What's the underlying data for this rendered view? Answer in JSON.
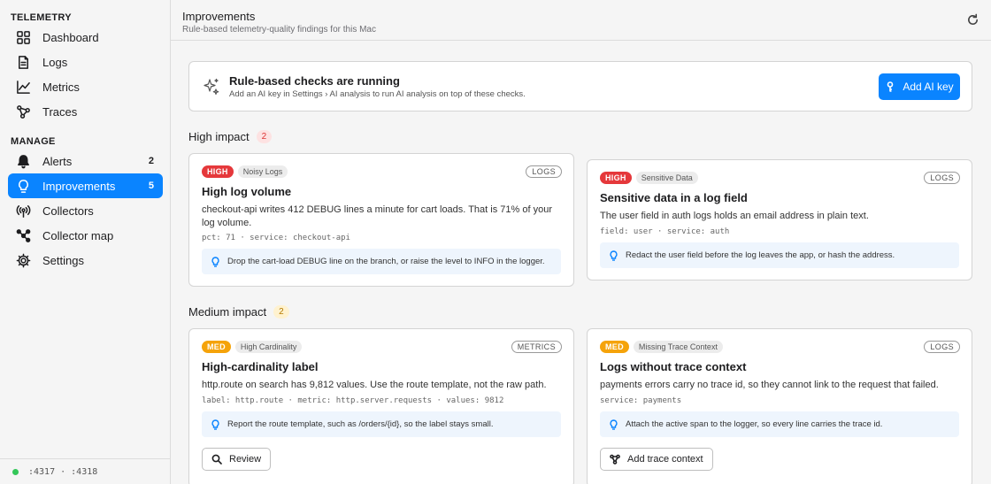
{
  "sidebar": {
    "telemetry_title": "TELEMETRY",
    "manage_title": "MANAGE",
    "items": [
      {
        "label": "Dashboard",
        "icon": "grid-icon"
      },
      {
        "label": "Logs",
        "icon": "document-icon"
      },
      {
        "label": "Metrics",
        "icon": "chart-line-icon"
      },
      {
        "label": "Traces",
        "icon": "trace-nodes-icon"
      },
      {
        "label": "Alerts",
        "icon": "bell-icon",
        "count": "2"
      },
      {
        "label": "Improvements",
        "icon": "lightbulb-icon",
        "count": "5"
      },
      {
        "label": "Collectors",
        "icon": "antenna-icon"
      },
      {
        "label": "Collector map",
        "icon": "network-icon"
      },
      {
        "label": "Settings",
        "icon": "gear-icon"
      }
    ],
    "footer": ":4317 · :4318"
  },
  "header": {
    "title": "Improvements",
    "subtitle": "Rule-based telemetry-quality findings for this Mac"
  },
  "banner": {
    "title": "Rule-based checks are running",
    "subtitle": "Add an AI key in Settings › AI analysis to run AI analysis on top of these checks.",
    "button": "Add AI key"
  },
  "groups": {
    "high": {
      "label": "High impact",
      "count": "2"
    },
    "medium": {
      "label": "Medium impact",
      "count": "2"
    }
  },
  "cards": [
    {
      "severity": "HIGH",
      "category": "Noisy Logs",
      "source": "LOGS",
      "title": "High log volume",
      "description": "checkout-api writes 412 DEBUG lines a minute for cart loads. That is 71% of your log volume.",
      "meta": "pct: 71 · service: checkout-api",
      "hint": "Drop the cart-load DEBUG line on the branch, or raise the level to INFO in the logger."
    },
    {
      "severity": "HIGH",
      "category": "Sensitive Data",
      "source": "LOGS",
      "title": "Sensitive data in a log field",
      "description": "The user field in auth logs holds an email address in plain text.",
      "meta": "field: user · service: auth",
      "hint": "Redact the user field before the log leaves the app, or hash the address."
    },
    {
      "severity": "MED",
      "category": "High Cardinality",
      "source": "METRICS",
      "title": "High-cardinality label",
      "description": "http.route on search has 9,812 values. Use the route template, not the raw path.",
      "meta": "label: http.route · metric: http.server.requests · values: 9812",
      "hint": "Report the route template, such as /orders/{id}, so the label stays small.",
      "action": "Review"
    },
    {
      "severity": "MED",
      "category": "Missing Trace Context",
      "source": "LOGS",
      "title": "Logs without trace context",
      "description": "payments errors carry no trace id, so they cannot link to the request that failed.",
      "meta": "service: payments",
      "hint": "Attach the active span to the logger, so every line carries the trace id.",
      "action": "Add trace context"
    }
  ],
  "colors": {
    "accent": "#0a84ff",
    "high": "#e5383b",
    "medium": "#f5a30a",
    "status_ok": "#34c759"
  }
}
